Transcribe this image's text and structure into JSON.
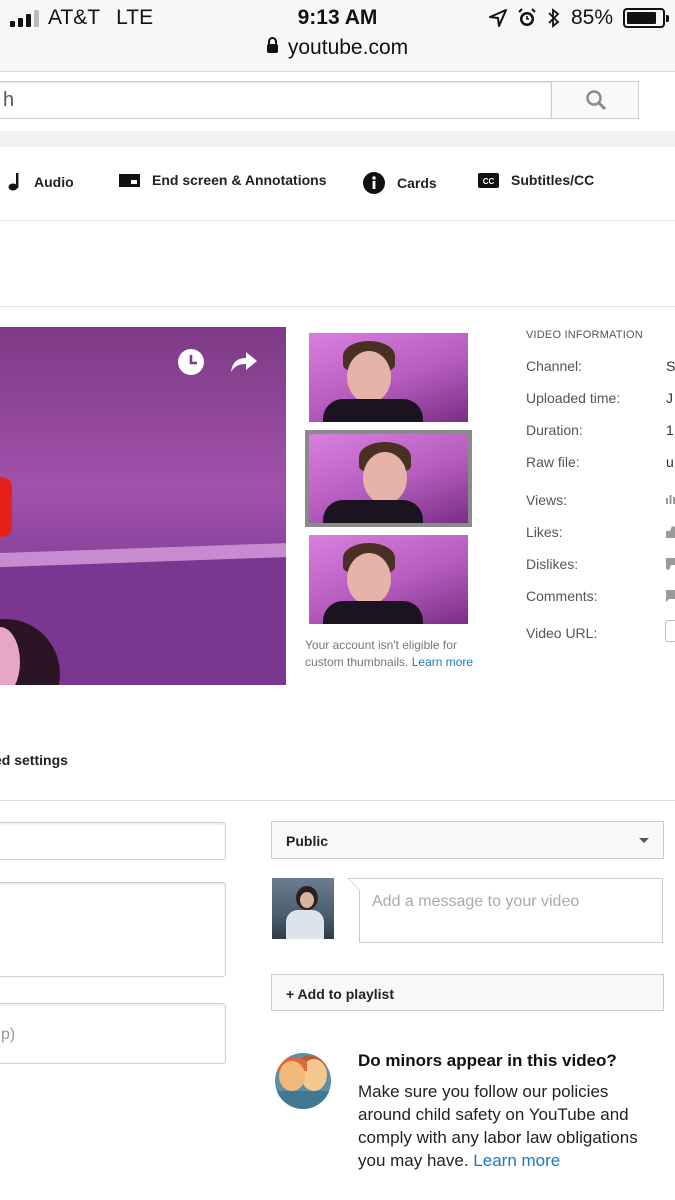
{
  "status_bar": {
    "carrier": "AT&T",
    "network": "LTE",
    "time": "9:13 AM",
    "battery_text": "85%",
    "battery_level": 0.85,
    "url": "youtube.com"
  },
  "search": {
    "value": "h"
  },
  "tabs": [
    {
      "label": "Audio",
      "icon": "music-note-icon"
    },
    {
      "label": "End screen & Annotations",
      "icon": "end-screen-icon"
    },
    {
      "label": "Cards",
      "icon": "info-icon"
    },
    {
      "label": "Subtitles/CC",
      "icon": "cc-icon"
    }
  ],
  "thumbnails": {
    "note": "Your account isn't eligible for custom thumbnails.",
    "learn_more": "Learn more"
  },
  "video_info": {
    "title": "VIDEO INFORMATION",
    "rows": [
      {
        "label": "Channel:",
        "value": "S"
      },
      {
        "label": "Uploaded time:",
        "value": "J"
      },
      {
        "label": "Duration:",
        "value": "1"
      },
      {
        "label": "Raw file:",
        "value": "u"
      },
      {
        "label": "Views:",
        "value": ""
      },
      {
        "label": "Likes:",
        "value": ""
      },
      {
        "label": "Dislikes:",
        "value": ""
      },
      {
        "label": "Comments:",
        "value": ""
      },
      {
        "label": "Video URL:",
        "value": ""
      }
    ]
  },
  "advanced": {
    "label": "ed settings"
  },
  "form": {
    "tags_partial": "p)",
    "privacy": "Public",
    "message_placeholder": "Add a message to your video",
    "add_to_playlist": "+ Add to playlist"
  },
  "minors": {
    "title": "Do minors appear in this video?",
    "body": "Make sure you follow our policies around child safety on YouTube and comply with any labor law obligations you may have.",
    "learn_more": "Learn more"
  },
  "colors": {
    "link": "#167ac6",
    "accent_red": "#e62117"
  }
}
